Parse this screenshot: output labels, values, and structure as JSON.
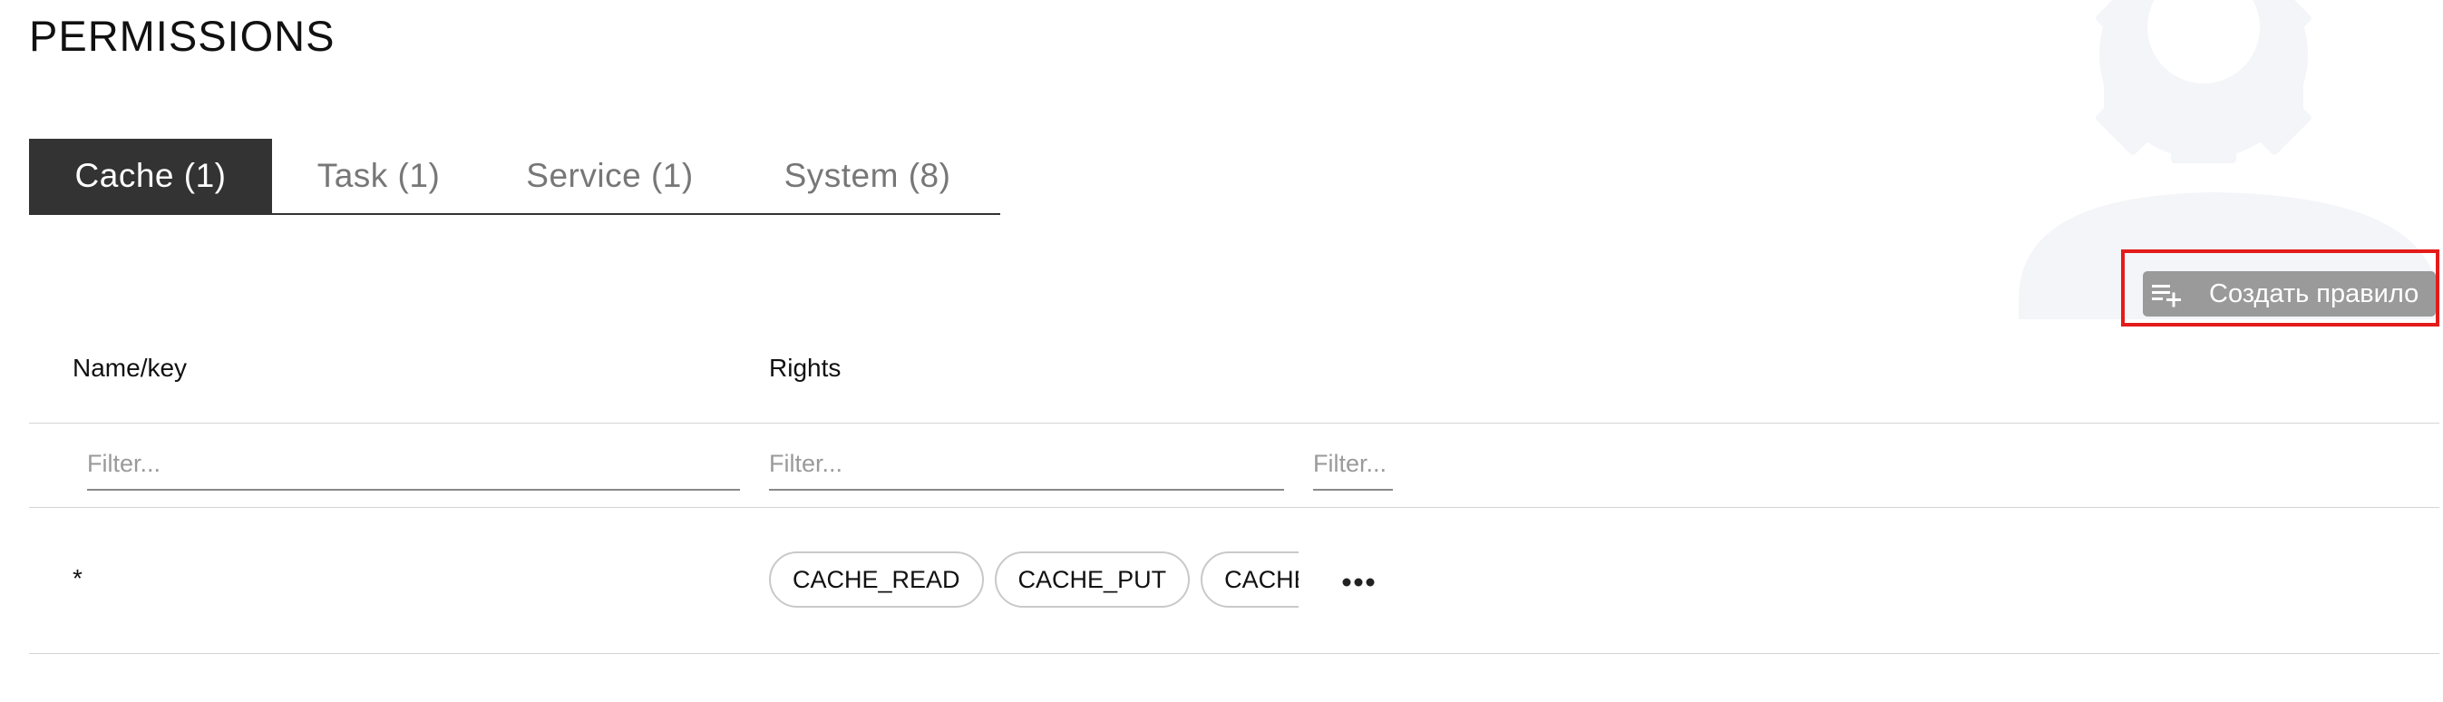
{
  "page": {
    "title": "PERMISSIONS"
  },
  "tabs": [
    {
      "label": "Cache (1)",
      "active": true
    },
    {
      "label": "Task (1)",
      "active": false
    },
    {
      "label": "Service (1)",
      "active": false
    },
    {
      "label": "System (8)",
      "active": false
    }
  ],
  "toolbar": {
    "create_label": "Создать правило",
    "create_icon": "playlist-add-icon",
    "highlight_color": "#e41b1b"
  },
  "table": {
    "columns": [
      "Name/key",
      "Rights"
    ],
    "filters": [
      {
        "placeholder": "Filter...",
        "value": ""
      },
      {
        "placeholder": "Filter...",
        "value": ""
      },
      {
        "placeholder": "Filter...",
        "value": ""
      }
    ],
    "rows": [
      {
        "key": "*",
        "rights": [
          "CACHE_READ",
          "CACHE_PUT",
          "CACHE_REMOVE"
        ],
        "more_icon": "more-horizontal-icon"
      }
    ]
  },
  "colors": {
    "active_tab_bg": "#333333",
    "button_bg": "#9a9a9a",
    "background_icon": "#f4f5f8"
  }
}
